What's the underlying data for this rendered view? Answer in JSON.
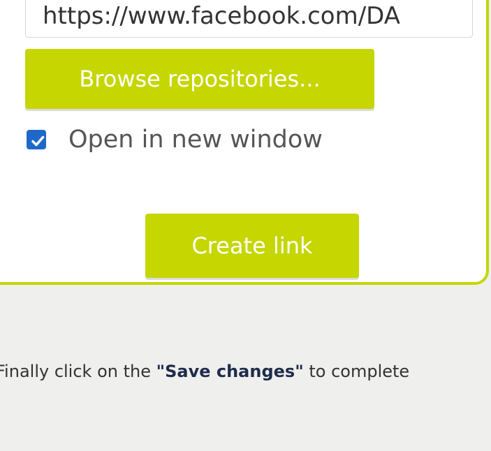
{
  "dialog": {
    "url_value": "https://www.facebook.com/DA",
    "browse_label": "Browse repositories...",
    "checkbox": {
      "label": "Open in new window",
      "checked": true
    },
    "create_label": "Create link"
  },
  "instruction": {
    "prefix": "Finally click on the ",
    "emphasis": "\"Save changes\"",
    "suffix": " to complete"
  },
  "colors": {
    "accent": "#c5d600",
    "checkbox_blue": "#1f68c9",
    "text_dark": "#1f2c4b",
    "background": "#efefed"
  }
}
